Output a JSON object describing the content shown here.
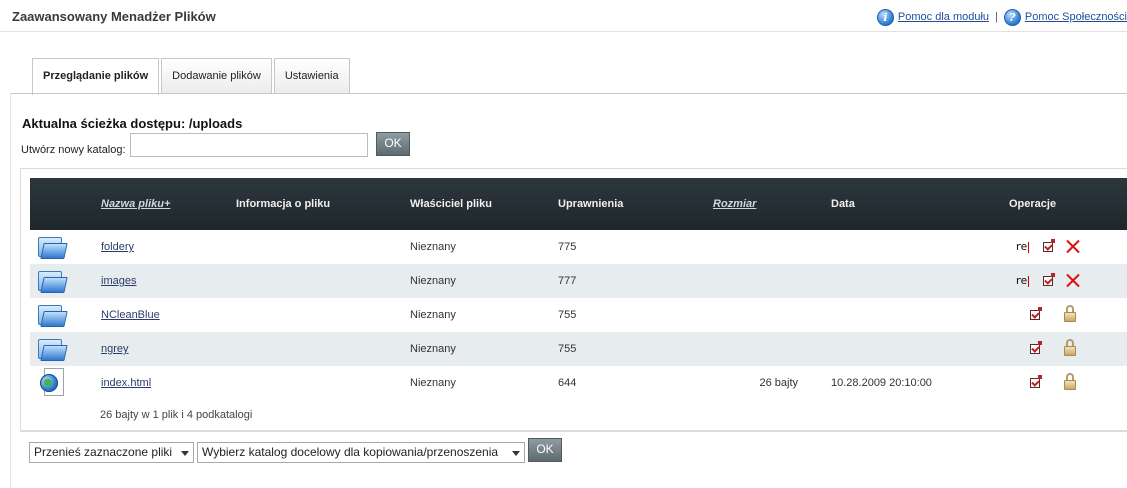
{
  "header": {
    "title": "Zaawansowany Menadżer Plików",
    "help_module": "Pomoc dla modułu",
    "help_separator": "|",
    "help_community": "Pomoc Społeczności",
    "help_icon": "help-icon"
  },
  "tabs": [
    {
      "label": "Przeglądanie plików",
      "active": true
    },
    {
      "label": "Dodawanie plików",
      "active": false
    },
    {
      "label": "Ustawienia",
      "active": false
    }
  ],
  "path": {
    "title": "Aktualna ścieżka dostępu: /uploads",
    "new_dir_label": "Utwórz nowy katalog:",
    "new_dir_value": "",
    "ok_label": "OK"
  },
  "table": {
    "columns": {
      "name": "Nazwa pliku+",
      "info": "Informacja o pliku",
      "owner": "Właściciel pliku",
      "perms": "Uprawnienia",
      "size": "Rozmiar",
      "date": "Data",
      "ops": "Operacje"
    },
    "rows": [
      {
        "name": "foldery",
        "owner": "Nieznany",
        "perms": "775",
        "size": "",
        "date": "",
        "type": "folder",
        "rename": "re"
      },
      {
        "name": "images",
        "owner": "Nieznany",
        "perms": "777",
        "size": "",
        "date": "",
        "type": "folder",
        "rename": "re"
      },
      {
        "name": "NCleanBlue",
        "owner": "Nieznany",
        "perms": "755",
        "size": "",
        "date": "",
        "type": "folder",
        "rename": ""
      },
      {
        "name": "ngrey",
        "owner": "Nieznany",
        "perms": "755",
        "size": "",
        "date": "",
        "type": "folder",
        "rename": ""
      },
      {
        "name": "index.html",
        "owner": "Nieznany",
        "perms": "644",
        "size": "26  bajty",
        "date": "10.28.2009 20:10:00",
        "type": "file",
        "rename": ""
      }
    ],
    "summary": "26 bajty w 1 plik i 4 podkatalogi"
  },
  "bottom": {
    "action_select": "Przenieś zaznaczone pliki",
    "target_select": "Wybierz katalog docelowy dla kopiowania/przenoszenia",
    "ok_label": "OK"
  },
  "colors": {
    "header_bar": "#2c373d",
    "alt_row": "#e7ecee",
    "link": "#2a3c6a",
    "button": "#6f7d83"
  }
}
